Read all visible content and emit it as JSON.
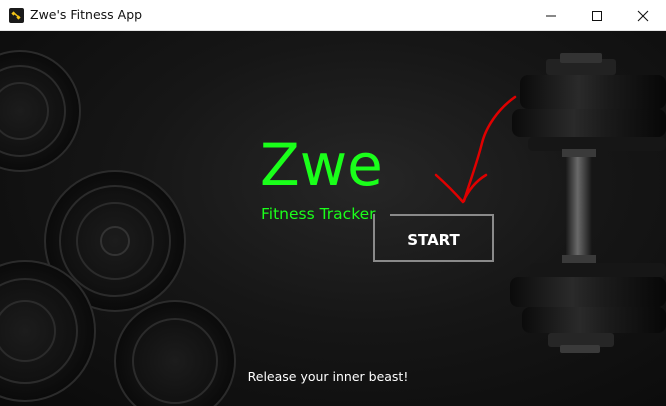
{
  "window": {
    "title": "Zwe's Fitness App",
    "app_icon": "dumbbell-app-icon",
    "controls": [
      "minimize-icon",
      "maximize-icon",
      "close-icon"
    ]
  },
  "hero": {
    "title": "Zwe",
    "subtitle": "Fitness Tracker",
    "start_label": "START",
    "tagline": "Release your inner beast!"
  },
  "colors": {
    "accent": "#1aff1a",
    "background": "#141414",
    "button_border": "#8a8a8a",
    "annotation": "#e00000"
  }
}
